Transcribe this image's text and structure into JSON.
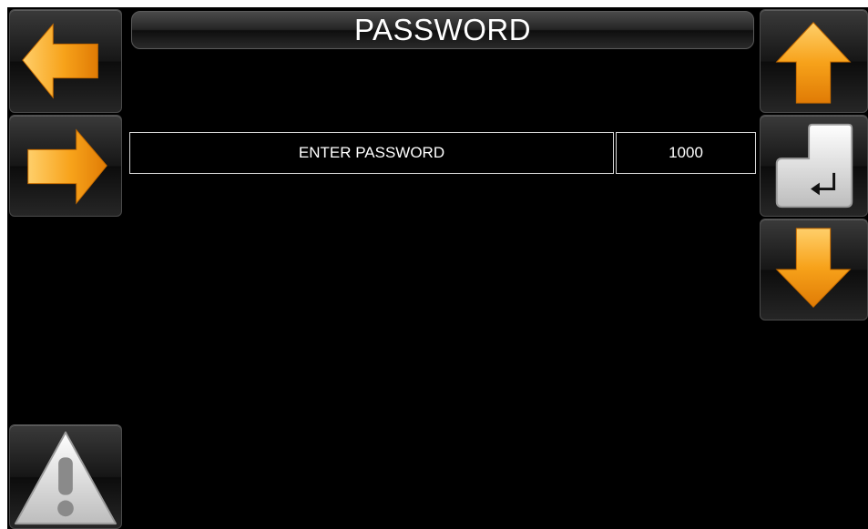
{
  "header": {
    "title": "PASSWORD"
  },
  "password_row": {
    "label": "ENTER PASSWORD",
    "value": "1000"
  },
  "icons": {
    "left": "arrow-left-icon",
    "right": "arrow-right-icon",
    "up": "arrow-up-icon",
    "enter": "enter-key-icon",
    "down": "arrow-down-icon",
    "alarm": "warning-icon"
  },
  "colors": {
    "background": "#000000",
    "arrow_accent": "#f7a21a",
    "text": "#ffffff",
    "field_border": "#d8d8d8"
  }
}
